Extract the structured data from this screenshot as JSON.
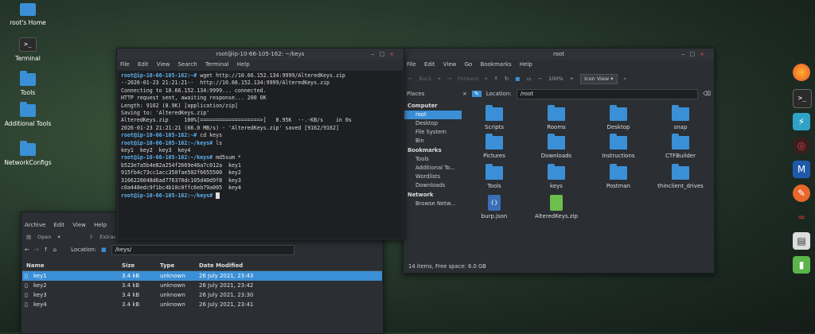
{
  "desktop": {
    "icons": [
      {
        "label": "root's Home",
        "icon": "home-folder-icon"
      },
      {
        "label": "Terminal",
        "icon": "terminal-icon"
      },
      {
        "label": "Tools",
        "icon": "folder-icon"
      },
      {
        "label": "Additional Tools",
        "icon": "folder-icon"
      },
      {
        "label": "NetworkConfigs",
        "icon": "folder-icon"
      }
    ]
  },
  "terminal": {
    "title": "root@ip-10-66-105-162: ~/keys",
    "menu": [
      "File",
      "Edit",
      "View",
      "Search",
      "Terminal",
      "Help"
    ],
    "lines": [
      {
        "prompt": "root@ip-10-66-105-162:~#",
        "text": " wget http://10.66.152.134:9999/AlteredKeys.zip"
      },
      {
        "prompt": "",
        "text": "--2026-01-23 21:21:21--  http://10.66.152.134:9999/AlteredKeys.zip"
      },
      {
        "prompt": "",
        "text": "Connecting to 10.66.152.134:9999... connected."
      },
      {
        "prompt": "",
        "text": "HTTP request sent, awaiting response... 200 OK"
      },
      {
        "prompt": "",
        "text": "Length: 9162 (8.9K) [application/zip]"
      },
      {
        "prompt": "",
        "text": "Saving to: 'AlteredKeys.zip'"
      },
      {
        "prompt": "",
        "text": ""
      },
      {
        "prompt": "",
        "text": "AlteredKeys.zip     100%[===================>]   8.95K  --.-KB/s    in 0s"
      },
      {
        "prompt": "",
        "text": ""
      },
      {
        "prompt": "",
        "text": "2026-01-23 21:21:21 (66.0 MB/s) - 'AlteredKeys.zip' saved [9162/9162]"
      },
      {
        "prompt": "",
        "text": ""
      },
      {
        "prompt": "root@ip-10-66-105-162:~#",
        "text": " cd keys"
      },
      {
        "prompt": "root@ip-10-66-105-162:~/keys#",
        "text": " ls"
      },
      {
        "prompt": "",
        "text": "key1  key2  key3  key4"
      },
      {
        "prompt": "root@ip-10-66-105-162:~/keys#",
        "text": " md5sum *"
      },
      {
        "prompt": "",
        "text": "b523e7a5b4e82a254f2669e46a7c012a  key1"
      },
      {
        "prompt": "",
        "text": "915fb4c73cc1acc350fae502f6655500  key2"
      },
      {
        "prompt": "",
        "text": "3166226048d6ad776370dc105d40d9f8  key3"
      },
      {
        "prompt": "",
        "text": "c0a448edc9f1bc4b10c0ffc6eb79a005  key4"
      },
      {
        "prompt": "root@ip-10-66-105-162:~/keys#",
        "text": " "
      }
    ]
  },
  "filemanager": {
    "title": "root",
    "menu": [
      "File",
      "Edit",
      "View",
      "Go",
      "Bookmarks",
      "Help"
    ],
    "toolbar": {
      "back": "Back",
      "forward": "Forward",
      "zoom": "100%",
      "view": "Icon View"
    },
    "location_label": "Location:",
    "location_value": "/root",
    "places": {
      "header": "Places",
      "sections": [
        {
          "title": "Computer",
          "items": [
            "root",
            "Desktop",
            "File System",
            "Bin"
          ]
        },
        {
          "title": "Bookmarks",
          "items": [
            "Tools",
            "Additional To...",
            "Wordlists",
            "Downloads"
          ]
        },
        {
          "title": "Network",
          "items": [
            "Browse Netw..."
          ]
        }
      ]
    },
    "items": [
      "Scripts",
      "Rooms",
      "Desktop",
      "snap",
      "Pictures",
      "Downloads",
      "Instructions",
      "CTFBuilder",
      "Tools",
      "keys",
      "Postman",
      "thinclient_drives",
      "burp.json",
      "AlteredKeys.zip"
    ],
    "status": "14 items, Free space: 6.0 GB"
  },
  "archive": {
    "menu": [
      "Archive",
      "Edit",
      "View",
      "Help"
    ],
    "toolbar": {
      "open": "Open",
      "extract": "Extract"
    },
    "location_label": "Location:",
    "location_value": "/keys/",
    "columns": [
      "Name",
      "Size",
      "Type",
      "Date Modified"
    ],
    "rows": [
      [
        "key1",
        "3.4 kB",
        "unknown",
        "26 July 2021, 23:43"
      ],
      [
        "key2",
        "3.4 kB",
        "unknown",
        "26 July 2021, 23:42"
      ],
      [
        "key3",
        "3.4 kB",
        "unknown",
        "26 July 2021, 23:30"
      ],
      [
        "key4",
        "3.4 kB",
        "unknown",
        "26 July 2021, 23:41"
      ]
    ]
  },
  "dock": [
    "firefox-icon",
    "terminal-icon",
    "zap-icon",
    "target-icon",
    "metasploit-icon",
    "burp-icon",
    "snake-icon",
    "files-icon",
    "archive-icon"
  ],
  "colors": {
    "accent": "#3b8fd6",
    "prompt": "#5fb3f0"
  }
}
